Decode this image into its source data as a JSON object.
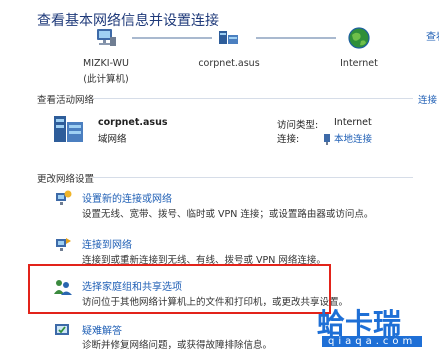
{
  "header": {
    "title": "查看基本网络信息并设置连接",
    "view_full_map": "查看"
  },
  "network_map": {
    "nodes": [
      {
        "name": "MIZKI-WU",
        "subtitle": "(此计算机)",
        "icon": "computer-icon"
      },
      {
        "name": "corpnet.asus",
        "icon": "network-icon"
      },
      {
        "name": "Internet",
        "icon": "globe-icon"
      }
    ]
  },
  "active_networks": {
    "label": "查看活动网络",
    "connect_disconnect": "连接",
    "network_name": "corpnet.asus",
    "network_type": "域网络",
    "access_type_label": "访问类型:",
    "access_type_value": "Internet",
    "connections_label": "连接:",
    "connections_value": "本地连接"
  },
  "change_settings": {
    "label": "更改网络设置",
    "tasks": [
      {
        "title": "设置新的连接或网络",
        "desc": "设置无线、宽带、拨号、临时或 VPN 连接；或设置路由器或访问点。",
        "icon": "new-connection-icon"
      },
      {
        "title": "连接到网络",
        "desc": "连接到或重新连接到无线、有线、拨号或 VPN 网络连接。",
        "icon": "connect-network-icon"
      },
      {
        "title": "选择家庭组和共享选项",
        "desc": "访问位于其他网络计算机上的文件和打印机，或更改共享设置。",
        "icon": "homegroup-icon"
      },
      {
        "title": "疑难解答",
        "desc": "诊断并修复网络问题，或获得故障排除信息。",
        "icon": "troubleshoot-icon"
      }
    ]
  },
  "watermark": {
    "text": "蛤卡瑞",
    "url": "qiaqa.com"
  },
  "colors": {
    "link": "#1f5fb5",
    "title": "#1f3a7a",
    "highlight": "#e2231a",
    "watermark": "#1e6fd6"
  }
}
